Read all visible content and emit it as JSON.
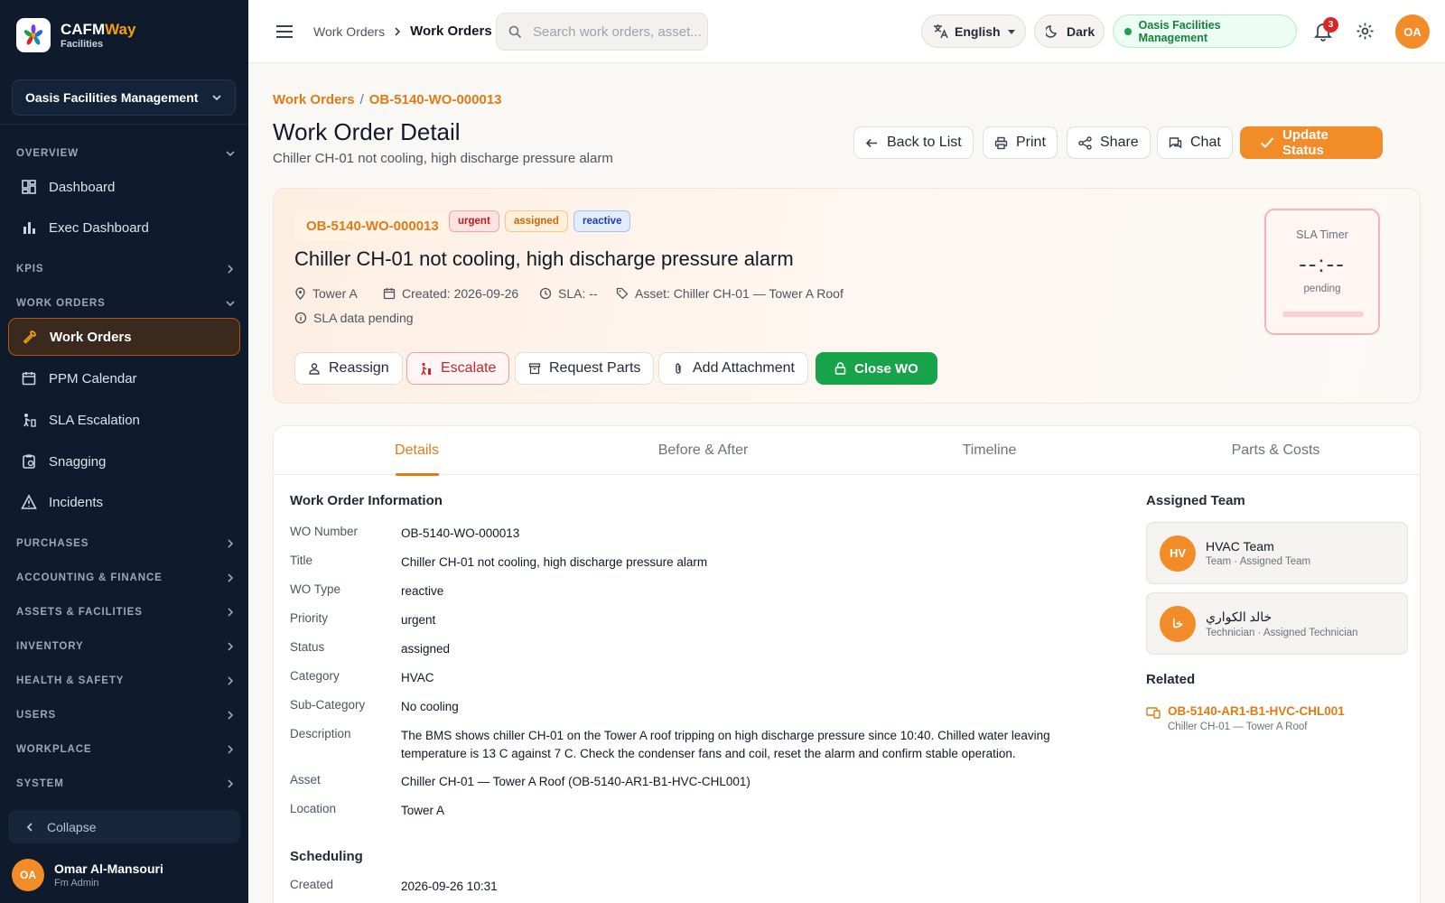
{
  "brand": {
    "name_part1": "CAFM",
    "name_part2": "Way",
    "subtitle": "Facilities"
  },
  "org_selector": {
    "value": "Oasis Facilities Management"
  },
  "sidebar": {
    "sections": {
      "overview": "OVERVIEW",
      "kpis": "KPIS",
      "work_orders": "WORK ORDERS",
      "purchases": "PURCHASES",
      "accounting": "ACCOUNTING & FINANCE",
      "assets": "ASSETS & FACILITIES",
      "inventory": "INVENTORY",
      "health": "HEALTH & SAFETY",
      "users": "USERS",
      "workplace": "WORKPLACE",
      "system": "SYSTEM"
    },
    "items": {
      "dashboard": "Dashboard",
      "exec": "Exec Dashboard",
      "work_orders": "Work Orders",
      "ppm": "PPM Calendar",
      "sla": "SLA Escalation",
      "snagging": "Snagging",
      "incidents": "Incidents"
    },
    "collapse": "Collapse",
    "user": {
      "initials": "OA",
      "name": "Omar Al-Mansouri",
      "role": "Fm Admin"
    }
  },
  "topbar": {
    "breadcrumb_parent": "Work Orders",
    "breadcrumb_current": "Work Orders",
    "search_placeholder": "Search work orders, asset...",
    "language": "English",
    "theme": "Dark",
    "org": "Oasis Facilities Management",
    "notifications": "3",
    "user_initials": "OA"
  },
  "page": {
    "crumb_link": "Work Orders",
    "crumb_current": "OB-5140-WO-000013",
    "title": "Work Order Detail",
    "subtitle": "Chiller CH-01 not cooling, high discharge pressure alarm",
    "actions": {
      "back": "Back to List",
      "print": "Print",
      "share": "Share",
      "chat": "Chat",
      "update": "Update Status"
    }
  },
  "hero": {
    "wo_number": "OB-5140-WO-000013",
    "badges": {
      "priority": "urgent",
      "status": "assigned",
      "type": "reactive"
    },
    "title": "Chiller CH-01 not cooling, high discharge pressure alarm",
    "location": "Tower A",
    "created": "Created: 2026-09-26",
    "sla": "SLA: --",
    "asset": "Asset: Chiller CH-01 — Tower A Roof",
    "sla_pending": "SLA data pending",
    "buttons": {
      "reassign": "Reassign",
      "escalate": "Escalate",
      "parts": "Request Parts",
      "attach": "Add Attachment",
      "close": "Close WO"
    },
    "sla_timer": {
      "label": "SLA Timer",
      "value": "--:--",
      "state": "pending"
    }
  },
  "tabs": [
    "Details",
    "Before & After",
    "Timeline",
    "Parts & Costs"
  ],
  "details": {
    "section_title": "Work Order Information",
    "fields": [
      {
        "k": "WO Number",
        "v": "OB-5140-WO-000013"
      },
      {
        "k": "Title",
        "v": "Chiller CH-01 not cooling, high discharge pressure alarm"
      },
      {
        "k": "WO Type",
        "v": "reactive"
      },
      {
        "k": "Priority",
        "v": "urgent"
      },
      {
        "k": "Status",
        "v": "assigned"
      },
      {
        "k": "Category",
        "v": "HVAC"
      },
      {
        "k": "Sub-Category",
        "v": "No cooling"
      },
      {
        "k": "Description",
        "v": "The BMS shows chiller CH-01 on the Tower A roof tripping on high discharge pressure since 10:40. Chilled water leaving temperature is 13 C against 7 C. Check the condenser fans and coil, reset the alarm and confirm stable operation."
      },
      {
        "k": "Asset",
        "v": "Chiller CH-01 — Tower A Roof (OB-5140-AR1-B1-HVC-CHL001)"
      },
      {
        "k": "Location",
        "v": "Tower A"
      }
    ],
    "scheduling_title": "Scheduling",
    "scheduling": [
      {
        "k": "Created",
        "v": "2026-09-26 10:31"
      }
    ]
  },
  "team": {
    "title": "Assigned Team",
    "members": [
      {
        "initials": "HV",
        "name": "HVAC Team",
        "role": "Team · Assigned Team"
      },
      {
        "initials": "خا",
        "name": "خالد الكواري",
        "role": "Technician · Assigned Technician"
      }
    ]
  },
  "related": {
    "title": "Related",
    "code": "OB-5140-AR1-B1-HVC-CHL001",
    "sub": "Chiller CH-01 — Tower A Roof"
  }
}
